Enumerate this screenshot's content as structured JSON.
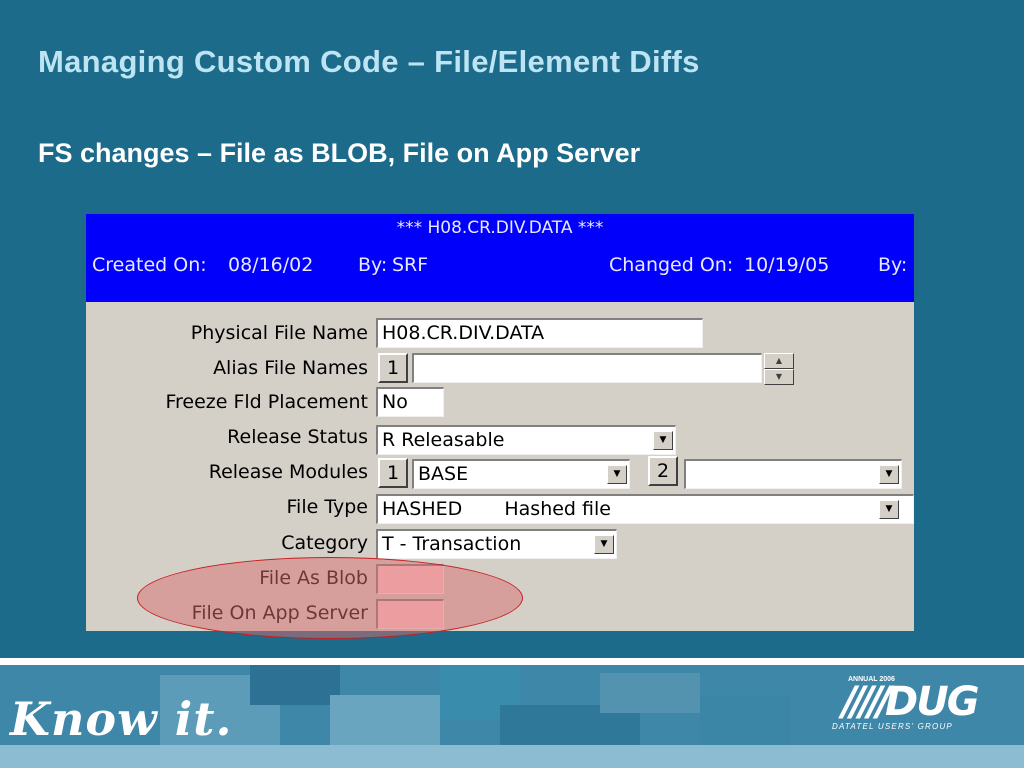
{
  "slide": {
    "title": "Managing Custom Code – File/Element Diffs",
    "subtitle": "FS changes – File as BLOB, File on App Server"
  },
  "screen": {
    "header": {
      "title": "*** H08.CR.DIV.DATA ***",
      "created_on_label": "Created On:",
      "created_on_value": "08/16/02",
      "by_label": "By:",
      "by_value": "SRF",
      "changed_on_label": "Changed On:",
      "changed_on_value": "10/19/05",
      "by2_label": "By:"
    },
    "fields": {
      "physical_file_name": {
        "label": "Physical File Name",
        "value": "H08.CR.DIV.DATA"
      },
      "alias_file_names": {
        "label": "Alias File Names",
        "index": "1",
        "value": ""
      },
      "freeze_fld_placement": {
        "label": "Freeze Fld Placement",
        "value": "No"
      },
      "release_status": {
        "label": "Release Status",
        "value": "R  Releasable"
      },
      "release_modules": {
        "label": "Release Modules",
        "index1": "1",
        "value1": "BASE",
        "index2": "2",
        "value2": ""
      },
      "file_type": {
        "label": "File Type",
        "code": "HASHED",
        "description": "Hashed file"
      },
      "category": {
        "label": "Category",
        "value": "T - Transaction"
      },
      "file_as_blob": {
        "label": "File As Blob",
        "value": ""
      },
      "file_on_app_server": {
        "label": "File On App Server",
        "value": ""
      }
    },
    "icons": {
      "dropdown": "chevron-down-icon",
      "spinner_up": "arrow-up-icon",
      "spinner_down": "arrow-down-icon"
    }
  },
  "footer": {
    "tagline": "Know it.",
    "logo": {
      "annual": "ANNUAL 2006",
      "wordmark": "DUG",
      "subtitle": "DATATEL USERS' GROUP"
    }
  },
  "colors": {
    "background": "#1c6b8a",
    "title": "#bde4f3",
    "header_bar": "#0000fb",
    "form_bg": "#d4d0c8",
    "highlight": "#d76e6e",
    "highlight_field": "#ffcdd0"
  }
}
